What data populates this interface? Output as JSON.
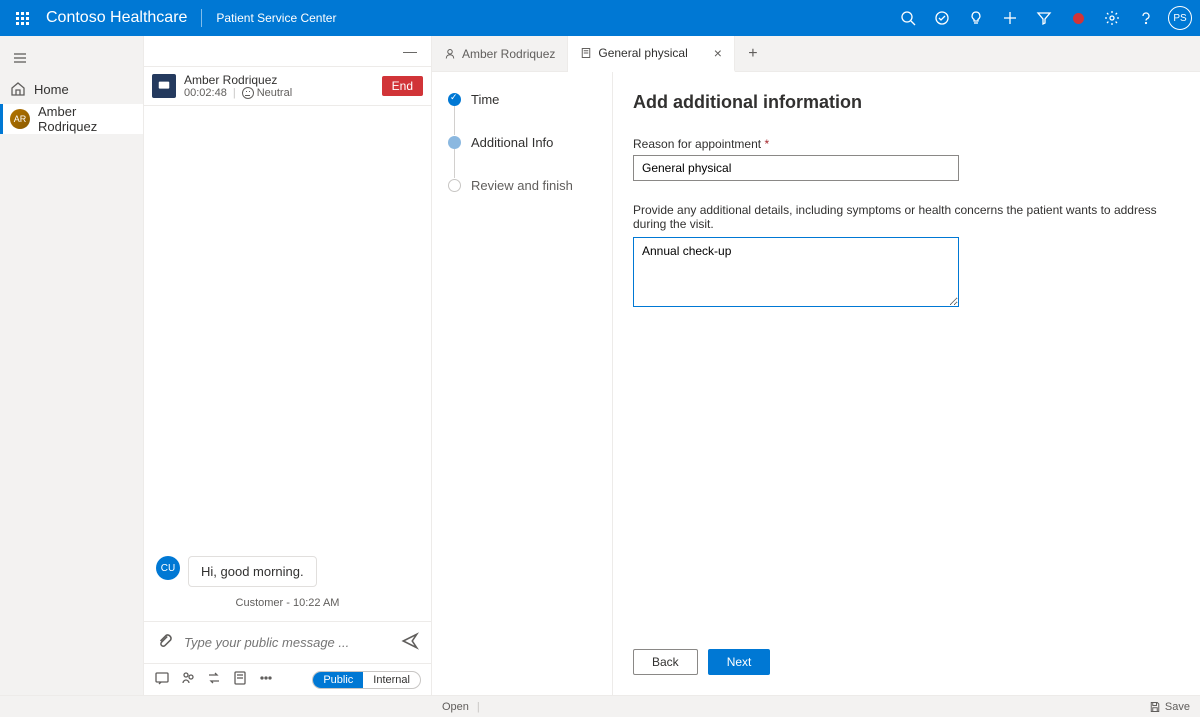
{
  "header": {
    "brand": "Contoso Healthcare",
    "subtitle": "Patient Service Center",
    "avatar_initials": "PS"
  },
  "leftnav": {
    "home_label": "Home",
    "patient_label": "Amber Rodriquez",
    "patient_initials": "AR"
  },
  "session": {
    "name": "Amber Rodriquez",
    "timer": "00:02:48",
    "sentiment": "Neutral",
    "end_label": "End"
  },
  "chat": {
    "customer_badge": "CU",
    "message_text": "Hi, good morning.",
    "meta_text": "Customer - 10:22 AM",
    "composer_placeholder": "Type your public message ...",
    "pill_public": "Public",
    "pill_internal": "Internal"
  },
  "tabs": {
    "tab1_label": "Amber Rodriquez",
    "tab2_label": "General physical"
  },
  "stepper": {
    "step1": "Time",
    "step2": "Additional Info",
    "step3": "Review and finish"
  },
  "form": {
    "title": "Add additional information",
    "reason_label": "Reason for appointment",
    "reason_value": "General physical",
    "details_label": "Provide any additional details, including symptoms or health concerns the patient wants to address during the visit.",
    "details_value": "Annual check-up",
    "back_label": "Back",
    "next_label": "Next"
  },
  "statusbar": {
    "open_label": "Open",
    "save_label": "Save"
  }
}
